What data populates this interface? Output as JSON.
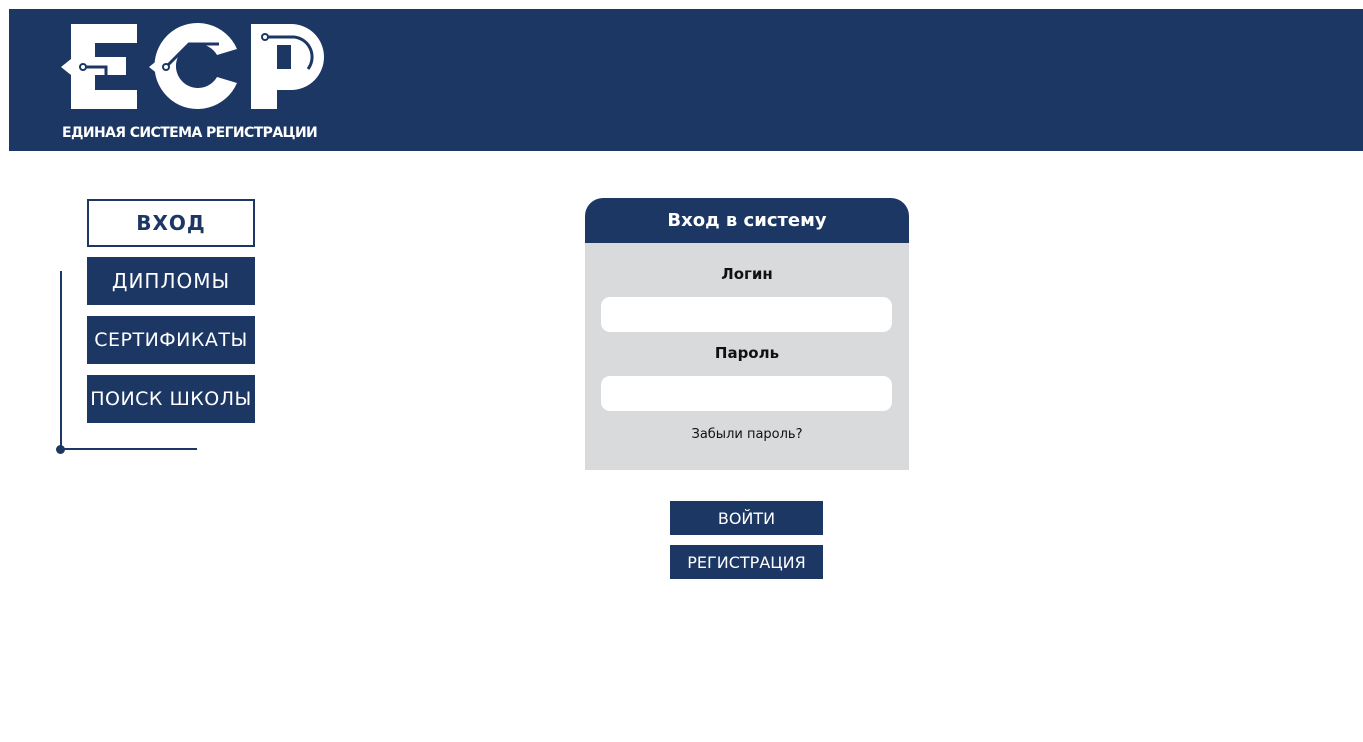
{
  "header": {
    "logo_letters": "ЕСР",
    "logo_caption": "ЕДИНАЯ СИСТЕМА РЕГИСТРАЦИИ"
  },
  "nav": {
    "items": [
      {
        "label": "ВХОД",
        "active": true
      },
      {
        "label": "ДИПЛОМЫ",
        "active": false
      },
      {
        "label": "СЕРТИФИКАТЫ",
        "active": false
      },
      {
        "label": "ПОИСК ШКОЛЫ",
        "active": false
      }
    ]
  },
  "login": {
    "title": "Вход в систему",
    "login_label": "Логин",
    "login_value": "",
    "password_label": "Пароль",
    "password_value": "",
    "forgot_link": "Забыли пароль?"
  },
  "actions": {
    "login_button": "ВОЙТИ",
    "register_button": "РЕГИСТРАЦИЯ"
  },
  "colors": {
    "brand": "#1c3764",
    "card_bg": "#d9dadb",
    "background": "#ffffff"
  }
}
